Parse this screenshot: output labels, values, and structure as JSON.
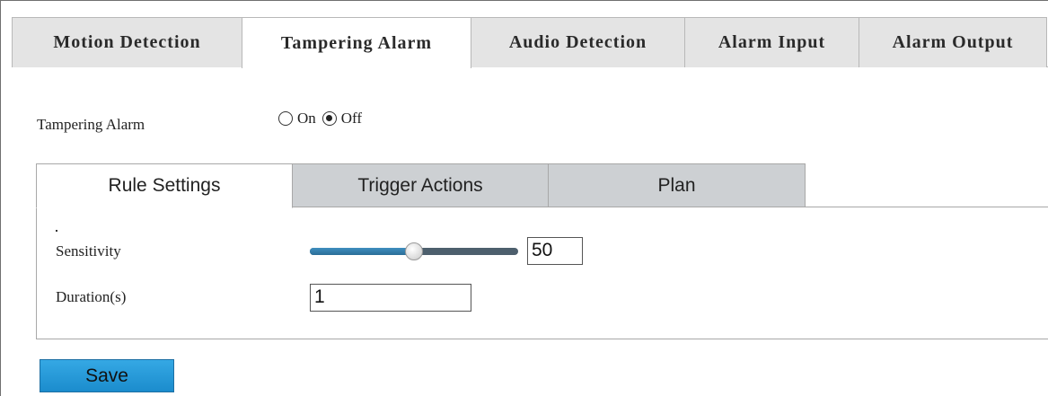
{
  "top_tabs": [
    {
      "label": "Motion Detection"
    },
    {
      "label": "Tampering Alarm"
    },
    {
      "label": "Audio Detection"
    },
    {
      "label": "Alarm Input"
    },
    {
      "label": "Alarm Output"
    }
  ],
  "active_top_tab": "Tampering Alarm",
  "tampering": {
    "label": "Tampering Alarm",
    "options": [
      {
        "label": "On",
        "checked": false
      },
      {
        "label": "Off",
        "checked": true
      }
    ]
  },
  "sub_tabs": [
    {
      "label": "Rule Settings"
    },
    {
      "label": "Trigger Actions"
    },
    {
      "label": "Plan"
    }
  ],
  "active_sub_tab": "Rule Settings",
  "rule": {
    "sensitivity_label": "Sensitivity",
    "sensitivity_value": "50",
    "sensitivity_fraction": 0.5,
    "duration_label": "Duration(s)",
    "duration_value": "1"
  },
  "save_label": "Save",
  "colors": {
    "slider_fill": "#2f80b3",
    "slider_track": "#4d5f6d",
    "save_button": "#23a0dc",
    "tab_inactive": "#e4e4e4",
    "subtab_inactive": "#cdd0d3"
  }
}
